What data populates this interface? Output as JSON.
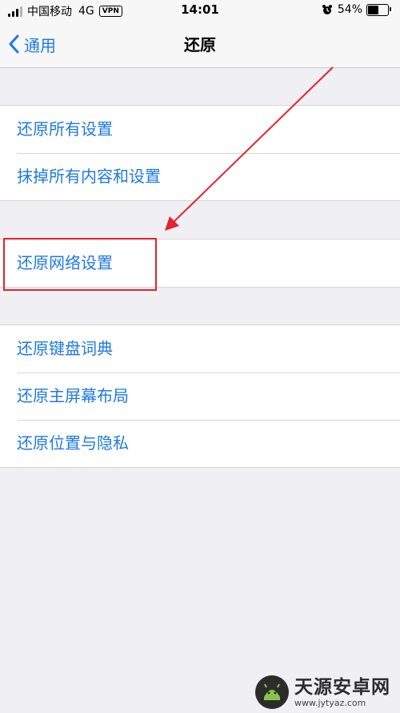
{
  "status_bar": {
    "carrier": "中国移动",
    "network": "4G",
    "vpn": "VPN",
    "time": "14:01",
    "battery": "54%",
    "battery_level": 0.54
  },
  "nav": {
    "back_label": "通用",
    "title": "还原"
  },
  "groups": [
    {
      "items": [
        "还原所有设置",
        "抹掉所有内容和设置"
      ]
    },
    {
      "items": [
        "还原网络设置"
      ]
    },
    {
      "items": [
        "还原键盘词典",
        "还原主屏幕布局",
        "还原位置与隐私"
      ]
    }
  ],
  "watermark": {
    "name": "天源安卓网",
    "url": "www.jytyaz.com"
  },
  "colors": {
    "accent": "#1f7ae0",
    "annotation": "#e3242b",
    "background": "#efeff4"
  }
}
